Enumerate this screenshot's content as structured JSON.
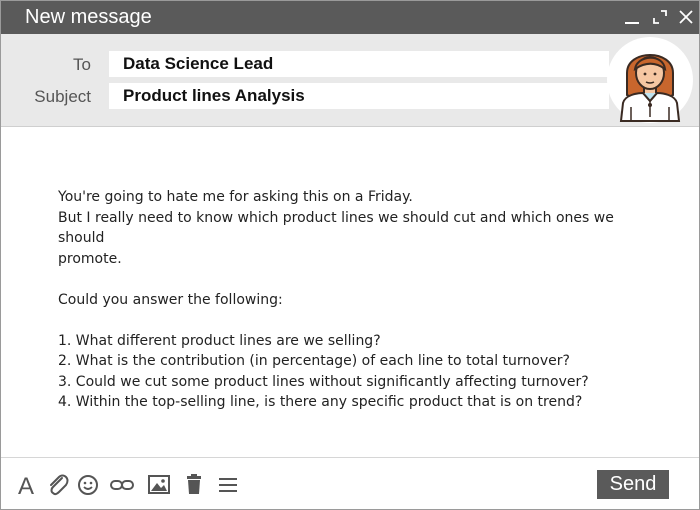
{
  "window": {
    "title": "New message"
  },
  "header": {
    "to_label": "To",
    "to_value": "Data Science Lead",
    "subject_label": "Subject",
    "subject_value": "Product lines Analysis"
  },
  "message": {
    "lines": [
      "You're going to hate me for asking this on a Friday.",
      "But I really need to know which product lines we should cut and which ones we should",
      "promote.",
      "",
      "Could you answer the following:",
      "",
      "1. What different product lines are we selling?",
      "2. What is the contribution (in percentage) of each line to total turnover?",
      "3. Could we cut some product lines without significantly affecting turnover?",
      "4. Within the top-selling line, is there any specific product that is on trend?"
    ]
  },
  "footer": {
    "send_label": "Send",
    "tools": [
      "font-icon",
      "paperclip-icon",
      "emoji-icon",
      "link-icon",
      "image-icon",
      "trash-icon",
      "menu-icon"
    ]
  },
  "colors": {
    "titlebar": "#5a5a5a",
    "header_bg": "#e9e9e9",
    "send_button": "#5a5a5a",
    "avatar_hair": "#c8662d",
    "avatar_skin": "#f6c7a3"
  }
}
